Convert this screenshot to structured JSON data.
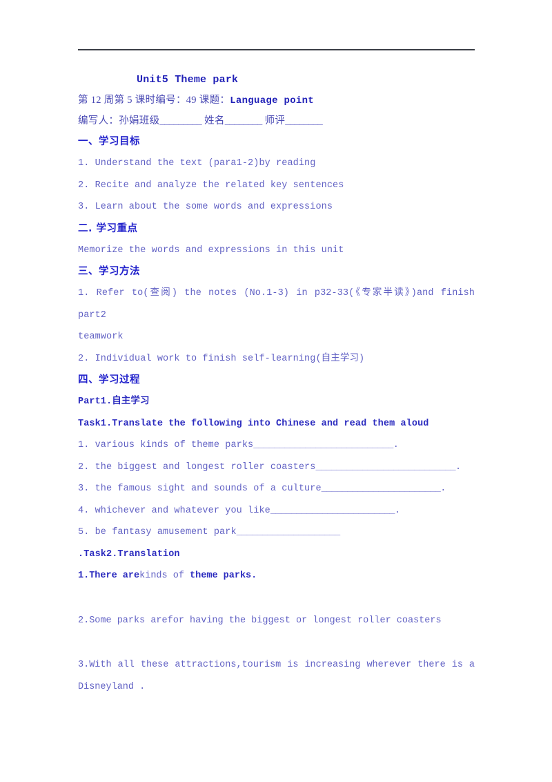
{
  "document": {
    "title": "Unit5  Theme park",
    "meta": {
      "lesson_info_cn": "第 12 周第 5 课时编号：49   课题：",
      "lesson_topic": "Language point",
      "author_label": "编写人：孙娟班级",
      "author_blank": "_________",
      "name_label": "  姓名",
      "name_blank": "________",
      "review_label": "   师评",
      "review_blank": "________"
    },
    "sections": [
      {
        "heading": "一、学习目标",
        "items": [
          "1. Understand the text (para1-2)by reading",
          "2. Recite and analyze the related key sentences",
          "3. Learn about the some words and expressions"
        ]
      },
      {
        "heading": "二. 学习重点",
        "items": [
          "Memorize the words and expressions in this unit"
        ]
      },
      {
        "heading": "三、学习方法",
        "items": [
          "1. Refer to(查阅) the notes (No.1-3) in p32-33(《专家半读》)and finish part2",
          "teamwork",
          "2. Individual work to finish self-learning(自主学习)"
        ]
      },
      {
        "heading": "四、学习过程",
        "items": []
      }
    ],
    "part1": {
      "heading": "Part1.自主学习",
      "task1": {
        "heading": "Task1.Translate the following into Chinese and read them aloud",
        "items": [
          {
            "num": "1. ",
            "text": "various kinds of theme parks",
            "blank": "___________________________",
            "tail": "."
          },
          {
            "num": "2. ",
            "text": "the biggest and longest roller coasters",
            "blank": "___________________________",
            "tail": "."
          },
          {
            "num": "3. ",
            "text": "the famous sight and sounds of a culture",
            "blank": "_______________________",
            "tail": "."
          },
          {
            "num": "4. ",
            "text": "whichever and whatever you like",
            "blank": "________________________",
            "tail": "."
          },
          {
            "num": "5. ",
            "text": "be fantasy amusement park",
            "blank": "____________________",
            "tail": ""
          }
        ]
      },
      "task2": {
        "heading": ".Task2.Translation",
        "sentences": [
          {
            "parts": [
              {
                "t": "1.There are",
                "bold": true
              },
              {
                "t": "kinds of ",
                "bold": false
              },
              {
                "t": "theme parks.",
                "bold": true
              }
            ]
          },
          {
            "parts": [
              {
                "t": "2.Some parks arefor having the biggest or longest roller coasters",
                "bold": false
              }
            ]
          },
          {
            "parts": [
              {
                "t": "3.With all these attractions,tourism is increasing wherever there is a",
                "bold": false
              }
            ]
          },
          {
            "parts": [
              {
                "t": "Disneyland .",
                "bold": false
              }
            ]
          }
        ]
      }
    }
  },
  "colors": {
    "rule": "#3b3f46",
    "heading_blue": "#2222cc",
    "body_blue": "#6161c4",
    "bold_blue": "#2b2bbf"
  }
}
